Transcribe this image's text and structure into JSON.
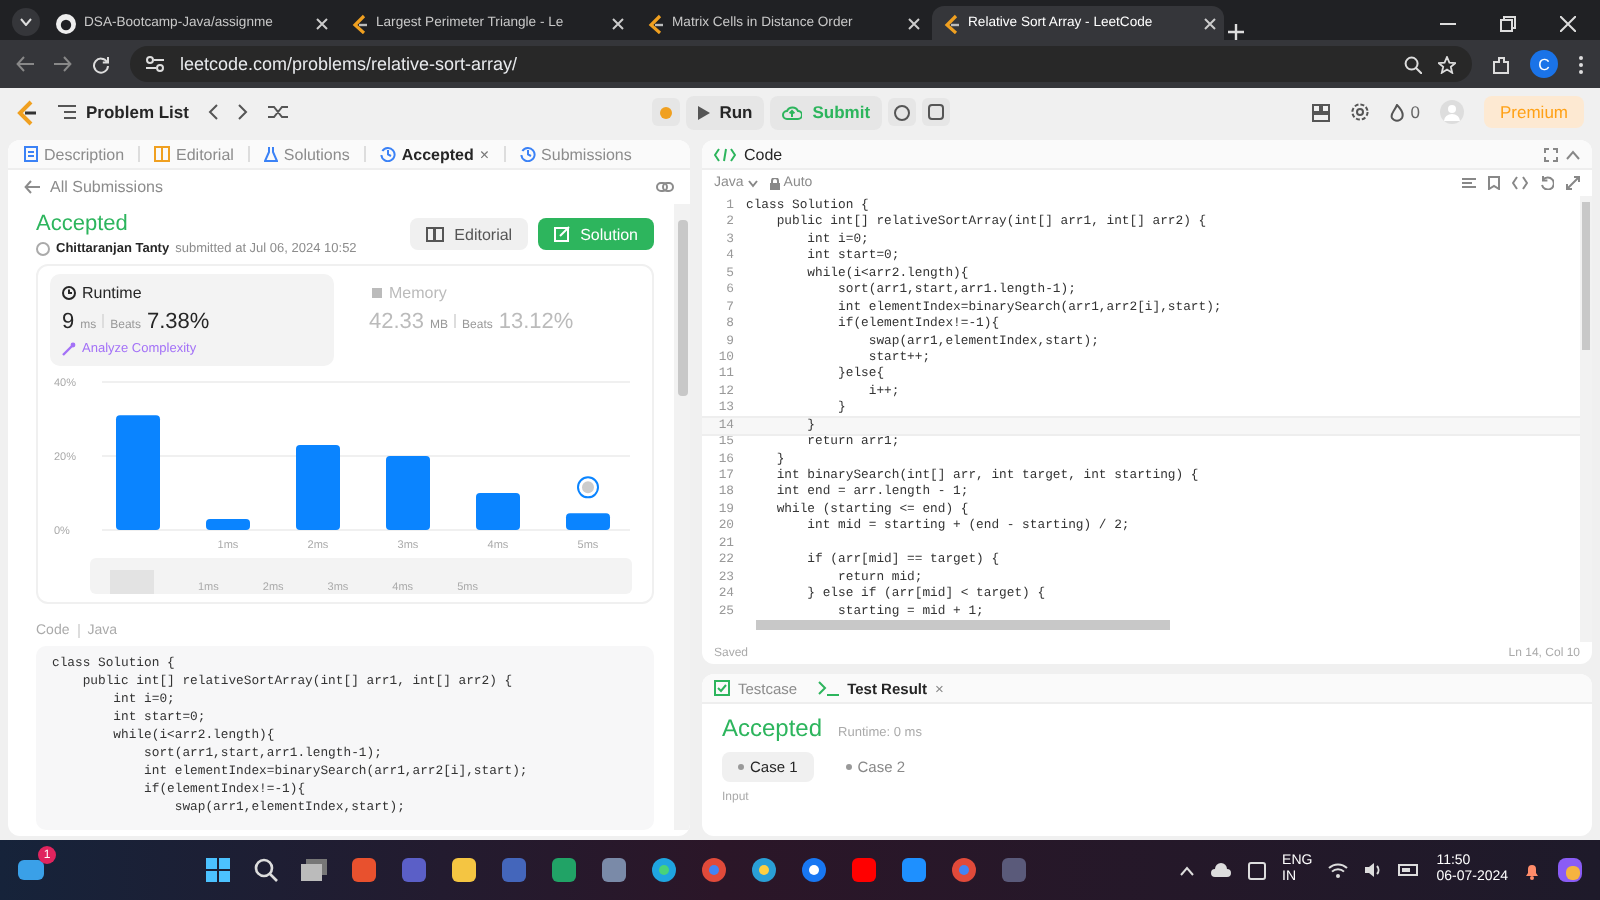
{
  "browser": {
    "tabs": [
      {
        "title": "DSA-Bootcamp-Java/assignme",
        "kind": "github",
        "selected": false
      },
      {
        "title": "Largest Perimeter Triangle - Le",
        "kind": "leetcode",
        "selected": false
      },
      {
        "title": "Matrix Cells in Distance Order",
        "kind": "leetcode",
        "selected": false
      },
      {
        "title": "Relative Sort Array - LeetCode",
        "kind": "leetcode",
        "selected": true
      }
    ],
    "url": "leetcode.com/problems/relative-sort-array/",
    "profile": "C"
  },
  "nav": {
    "problem_list": "Problem List",
    "run": "Run",
    "submit": "Submit",
    "streak": "0",
    "premium": "Premium"
  },
  "left": {
    "tabs": [
      {
        "label": "Description",
        "kind": "description",
        "selected": false
      },
      {
        "label": "Editorial",
        "kind": "editorial",
        "selected": false
      },
      {
        "label": "Solutions",
        "kind": "solutions",
        "selected": false
      },
      {
        "label": "Accepted",
        "kind": "accepted",
        "selected": true,
        "close": "×"
      },
      {
        "label": "Submissions",
        "kind": "submissions",
        "selected": false
      }
    ],
    "all_submissions": "All Submissions",
    "status": "Accepted",
    "author": "Chittaranjan Tanty",
    "submitted": "submitted at Jul 06, 2024 10:52",
    "buttons": [
      {
        "label": "Editorial",
        "kind": "secondary"
      },
      {
        "label": "Solution",
        "kind": "primary"
      }
    ],
    "metrics": [
      {
        "title": "Runtime",
        "value": "9",
        "unit": "ms",
        "beats_label": "Beats",
        "beats": "7.38%",
        "selected": true,
        "link": "Analyze Complexity"
      },
      {
        "title": "Memory",
        "value": "42.33",
        "unit": "MB",
        "beats_label": "Beats",
        "beats": "13.12%",
        "selected": false
      }
    ],
    "chart_data": {
      "type": "bar",
      "categories": [
        null,
        "1ms",
        "2ms",
        "3ms",
        "4ms",
        "5ms"
      ],
      "values": [
        31,
        3,
        23,
        20,
        10,
        4.5
      ],
      "ylim": [
        0,
        40
      ],
      "yticks": [
        {
          "value": 0,
          "label": "0%"
        },
        {
          "value": 20,
          "label": "20%"
        },
        {
          "value": 40,
          "label": "40%"
        }
      ]
    },
    "overview_labels": [
      "1ms",
      "2ms",
      "3ms",
      "4ms",
      "5ms"
    ],
    "code_label": "Code",
    "code_lang": "Java",
    "code": [
      "class Solution {",
      "    public int[] relativeSortArray(int[] arr1, int[] arr2) {",
      "        int i=0;",
      "        int start=0;",
      "        while(i<arr2.length){",
      "            sort(arr1,start,arr1.length-1);",
      "            int elementIndex=binarySearch(arr1,arr2[i],start);",
      "            if(elementIndex!=-1){",
      "                swap(arr1,elementIndex,start);"
    ]
  },
  "editor": {
    "title": "Code",
    "language": "Java",
    "mode": "Auto",
    "status": "Saved",
    "cursor": "Ln 14, Col 10",
    "lines": [
      {
        "n": "1",
        "text": "class Solution {",
        "current": false
      },
      {
        "n": "2",
        "text": "    public int[] relativeSortArray(int[] arr1, int[] arr2) {",
        "current": false
      },
      {
        "n": "3",
        "text": "        int i=0;",
        "current": false
      },
      {
        "n": "4",
        "text": "        int start=0;",
        "current": false
      },
      {
        "n": "5",
        "text": "        while(i<arr2.length){",
        "current": false
      },
      {
        "n": "6",
        "text": "            sort(arr1,start,arr1.length-1);",
        "current": false
      },
      {
        "n": "7",
        "text": "            int elementIndex=binarySearch(arr1,arr2[i],start);",
        "current": false
      },
      {
        "n": "8",
        "text": "            if(elementIndex!=-1){",
        "current": false
      },
      {
        "n": "9",
        "text": "                swap(arr1,elementIndex,start);",
        "current": false
      },
      {
        "n": "10",
        "text": "                start++;",
        "current": false
      },
      {
        "n": "11",
        "text": "            }else{",
        "current": false
      },
      {
        "n": "12",
        "text": "                i++;",
        "current": false
      },
      {
        "n": "13",
        "text": "            }",
        "current": false
      },
      {
        "n": "14",
        "text": "        }",
        "current": true
      },
      {
        "n": "15",
        "text": "        return arr1;",
        "current": false
      },
      {
        "n": "16",
        "text": "    }",
        "current": false
      },
      {
        "n": "17",
        "text": "    int binarySearch(int[] arr, int target, int starting) {",
        "current": false
      },
      {
        "n": "18",
        "text": "    int end = arr.length - 1;",
        "current": false
      },
      {
        "n": "19",
        "text": "    while (starting <= end) {",
        "current": false
      },
      {
        "n": "20",
        "text": "        int mid = starting + (end - starting) / 2;",
        "current": false
      },
      {
        "n": "21",
        "current": false
      },
      {
        "n": "22",
        "text": "        if (arr[mid] == target) {",
        "current": false
      },
      {
        "n": "23",
        "text": "            return mid;",
        "current": false
      },
      {
        "n": "24",
        "text": "        } else if (arr[mid] < target) {",
        "current": false
      },
      {
        "n": "25",
        "text": "            starting = mid + 1;",
        "current": false
      }
    ]
  },
  "result": {
    "tabs": [
      {
        "label": "Testcase",
        "kind": "testcase",
        "selected": false
      },
      {
        "label": "Test Result",
        "kind": "result",
        "selected": true,
        "close": "×"
      }
    ],
    "status": "Accepted",
    "runtime": "Runtime: 0 ms",
    "cases": [
      {
        "label": "Case 1",
        "selected": true
      },
      {
        "label": "Case 2",
        "selected": false
      }
    ],
    "input_label": "Input"
  },
  "taskbar": {
    "badge": "1",
    "lang": "ENG",
    "region": "IN",
    "time": "11:50",
    "date": "06-07-2024"
  }
}
